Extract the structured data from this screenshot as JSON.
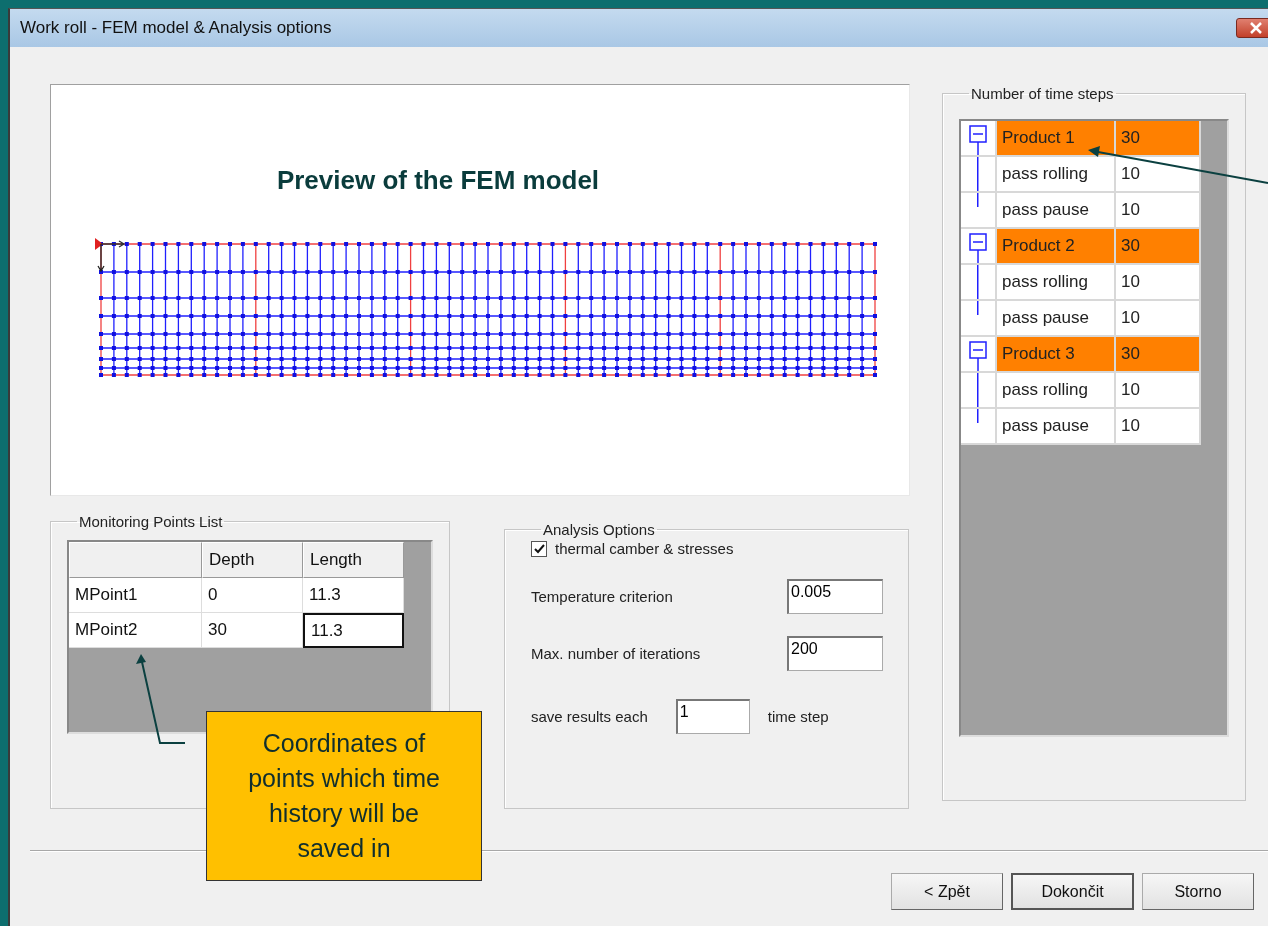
{
  "window": {
    "title": "Work roll - FEM model & Analysis options"
  },
  "preview": {
    "title": "Preview of the FEM model"
  },
  "monitoring_points": {
    "title": "Monitoring Points List",
    "columns": [
      "Depth",
      "Length"
    ],
    "rows": [
      {
        "name": "MPoint1",
        "depth": "0",
        "length": "11.3",
        "length_focused": false
      },
      {
        "name": "MPoint2",
        "depth": "30",
        "length": "11.3",
        "length_focused": true
      }
    ]
  },
  "analysis_options": {
    "title": "Analysis Options",
    "checkbox": {
      "label": "thermal camber & stresses",
      "checked": true
    },
    "fields": [
      {
        "label": "Temperature criterion",
        "value": "0.005"
      },
      {
        "label": "Max. number of iterations",
        "value": "200"
      }
    ],
    "save_results": {
      "label": "save results each",
      "value": "1",
      "suffix": "time step"
    }
  },
  "time_steps": {
    "title": "Number of time steps",
    "products": [
      {
        "name": "Product 1",
        "value": "30",
        "expanded": true,
        "children": [
          {
            "name": "pass rolling",
            "value": "10"
          },
          {
            "name": "pass pause",
            "value": "10"
          }
        ]
      },
      {
        "name": "Product 2",
        "value": "30",
        "expanded": true,
        "children": [
          {
            "name": "pass rolling",
            "value": "10"
          },
          {
            "name": "pass pause",
            "value": "10"
          }
        ]
      },
      {
        "name": "Product 3",
        "value": "30",
        "expanded": true,
        "children": [
          {
            "name": "pass rolling",
            "value": "10"
          },
          {
            "name": "pass pause",
            "value": "10"
          }
        ]
      }
    ]
  },
  "callout": {
    "text": "Coordinates of points which time history will be saved in"
  },
  "buttons": [
    {
      "label": "< Zpět",
      "default": false
    },
    {
      "label": "Dokončit",
      "default": true
    },
    {
      "label": "Storno",
      "default": false
    }
  ]
}
